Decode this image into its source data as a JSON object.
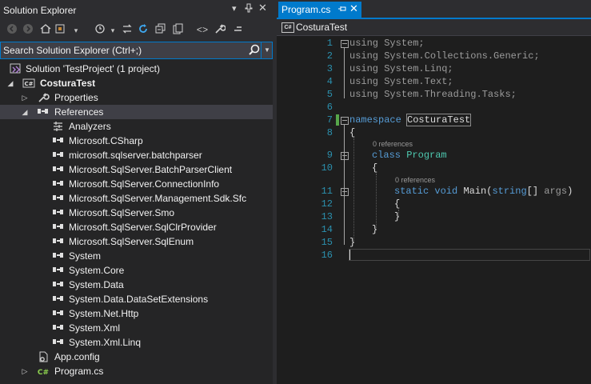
{
  "solution_explorer": {
    "title": "Solution Explorer",
    "search_placeholder": "Search Solution Explorer (Ctrl+;)",
    "tree": [
      {
        "label": "Solution 'TestProject' (1 project)",
        "icon": "solution-icon",
        "bold": false
      },
      {
        "label": "CosturaTest",
        "icon": "csharp-project-icon",
        "bold": true
      },
      {
        "label": "Properties",
        "icon": "wrench-icon"
      },
      {
        "label": "References",
        "icon": "reference-icon"
      },
      {
        "label": "Analyzers",
        "icon": "analyzer-icon"
      },
      {
        "label": "Microsoft.CSharp",
        "icon": "reference-icon"
      },
      {
        "label": "microsoft.sqlserver.batchparser",
        "icon": "reference-icon"
      },
      {
        "label": "Microsoft.SqlServer.BatchParserClient",
        "icon": "reference-icon"
      },
      {
        "label": "Microsoft.SqlServer.ConnectionInfo",
        "icon": "reference-icon"
      },
      {
        "label": "Microsoft.SqlServer.Management.Sdk.Sfc",
        "icon": "reference-icon"
      },
      {
        "label": "Microsoft.SqlServer.Smo",
        "icon": "reference-icon"
      },
      {
        "label": "Microsoft.SqlServer.SqlClrProvider",
        "icon": "reference-icon"
      },
      {
        "label": "Microsoft.SqlServer.SqlEnum",
        "icon": "reference-icon"
      },
      {
        "label": "System",
        "icon": "reference-icon"
      },
      {
        "label": "System.Core",
        "icon": "reference-icon"
      },
      {
        "label": "System.Data",
        "icon": "reference-icon"
      },
      {
        "label": "System.Data.DataSetExtensions",
        "icon": "reference-icon"
      },
      {
        "label": "System.Net.Http",
        "icon": "reference-icon"
      },
      {
        "label": "System.Xml",
        "icon": "reference-icon"
      },
      {
        "label": "System.Xml.Linq",
        "icon": "reference-icon"
      },
      {
        "label": "App.config",
        "icon": "config-file-icon"
      },
      {
        "label": "Program.cs",
        "icon": "csharp-file-icon"
      }
    ]
  },
  "editor": {
    "tab_label": "Program.cs",
    "nav_label": "CosturaTest",
    "nav_badge": "C#",
    "references_hint": "0 references",
    "lines": [
      "1",
      "2",
      "3",
      "4",
      "5",
      "6",
      "7",
      "8",
      "9",
      "10",
      "11",
      "12",
      "13",
      "14",
      "15",
      "16"
    ],
    "code": {
      "using": "using",
      "u1": "System;",
      "u2": "System.Collections.Generic;",
      "u3": "System.Linq;",
      "u4": "System.Text;",
      "u5": "System.Threading.Tasks;",
      "namespace_kw": "namespace",
      "namespace_name": "CosturaTest",
      "open_brace": "{",
      "close_brace": "}",
      "class_kw": "class",
      "class_name": "Program",
      "static_kw": "static",
      "void_kw": "void",
      "method_name": "Main",
      "open_paren": "(",
      "string_kw": "string",
      "array_suffix": "[] ",
      "param_name": "args",
      "close_paren": ")"
    }
  },
  "colors": {
    "accent": "#007acc",
    "keyword": "#569cd6",
    "type": "#4ec9b0",
    "line_number": "#2b91af"
  }
}
